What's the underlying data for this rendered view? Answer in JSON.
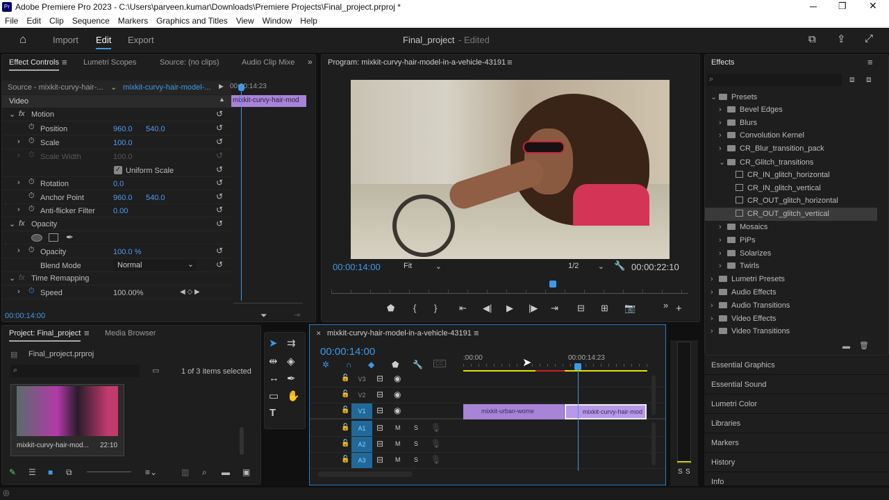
{
  "app": {
    "title": "Adobe Premiere Pro 2023 - C:\\Users\\parveen.kumar\\Downloads\\Premiere Projects\\Final_project.prproj *",
    "logo": "Pr"
  },
  "menu": [
    "File",
    "Edit",
    "Clip",
    "Sequence",
    "Markers",
    "Graphics and Titles",
    "View",
    "Window",
    "Help"
  ],
  "header": {
    "tabs": [
      "Import",
      "Edit",
      "Export"
    ],
    "active": "Edit",
    "project": "Final_project",
    "status": "- Edited"
  },
  "effect_controls": {
    "tabs": [
      "Effect Controls",
      "Lumetri Scopes",
      "Source: (no clips)",
      "Audio Clip Mixe"
    ],
    "source": "Source - mixkit-curvy-hair-...",
    "sequence": "mixkit-curvy-hair-model-...",
    "mini_time": "00:00:14:23",
    "mini_clip": "mixkit-curvy-hair-mod",
    "section": "Video",
    "motion": "Motion",
    "position": {
      "label": "Position",
      "x": "960.0",
      "y": "540.0"
    },
    "scale": {
      "label": "Scale",
      "v": "100.0"
    },
    "scale_width": {
      "label": "Scale Width",
      "v": "100.0"
    },
    "uniform": "Uniform Scale",
    "rotation": {
      "label": "Rotation",
      "v": "0.0"
    },
    "anchor": {
      "label": "Anchor Point",
      "x": "960.0",
      "y": "540.0"
    },
    "antiflicker": {
      "label": "Anti-flicker Filter",
      "v": "0.00"
    },
    "opacity_group": "Opacity",
    "opacity": {
      "label": "Opacity",
      "v": "100.0 %"
    },
    "blend": {
      "label": "Blend Mode",
      "v": "Normal"
    },
    "time_remap": "Time Remapping",
    "speed": {
      "label": "Speed",
      "v": "100.00%"
    },
    "timecode": "00:00:14:00"
  },
  "program": {
    "title": "Program: mixkit-curvy-hair-model-in-a-vehicle-43191",
    "timecode": "00:00:14:00",
    "fit": "Fit",
    "quality": "1/2",
    "duration": "00:00:22:10",
    "playhead_fraction": 0.62
  },
  "effects": {
    "title": "Effects",
    "tree": [
      {
        "label": "Presets",
        "level": 0,
        "open": true,
        "type": "folder"
      },
      {
        "label": "Bevel Edges",
        "level": 1,
        "type": "folder"
      },
      {
        "label": "Blurs",
        "level": 1,
        "type": "folder"
      },
      {
        "label": "Convolution Kernel",
        "level": 1,
        "type": "folder"
      },
      {
        "label": "CR_Blur_transition_pack",
        "level": 1,
        "type": "folder"
      },
      {
        "label": "CR_Glitch_transitions",
        "level": 1,
        "open": true,
        "type": "folder"
      },
      {
        "label": "CR_IN_glitch_horizontal",
        "level": 2,
        "type": "preset"
      },
      {
        "label": "CR_IN_glitch_vertical",
        "level": 2,
        "type": "preset"
      },
      {
        "label": "CR_OUT_glitch_horizontal",
        "level": 2,
        "type": "preset"
      },
      {
        "label": "CR_OUT_glitch_vertical",
        "level": 2,
        "type": "preset",
        "selected": true
      },
      {
        "label": "Mosaics",
        "level": 1,
        "type": "folder"
      },
      {
        "label": "PiPs",
        "level": 1,
        "type": "folder"
      },
      {
        "label": "Solarizes",
        "level": 1,
        "type": "folder"
      },
      {
        "label": "Twirls",
        "level": 1,
        "type": "folder"
      },
      {
        "label": "Lumetri Presets",
        "level": 0,
        "type": "folder"
      },
      {
        "label": "Audio Effects",
        "level": 0,
        "type": "folder"
      },
      {
        "label": "Audio Transitions",
        "level": 0,
        "type": "folder"
      },
      {
        "label": "Video Effects",
        "level": 0,
        "type": "folder"
      },
      {
        "label": "Video Transitions",
        "level": 0,
        "type": "folder"
      }
    ],
    "docks": [
      "Essential Graphics",
      "Essential Sound",
      "Lumetri Color",
      "Libraries",
      "Markers",
      "History",
      "Info"
    ]
  },
  "project": {
    "tabs": [
      "Project: Final_project",
      "Media Browser"
    ],
    "file": "Final_project.prproj",
    "selection": "1 of 3 items selected",
    "clip_name": "mixkit-curvy-hair-mod...",
    "clip_duration": "22:10"
  },
  "timeline": {
    "title": "mixkit-curvy-hair-model-in-a-vehicle-43191",
    "timecode": "00:00:14:00",
    "ruler": [
      ":00:00",
      "00:00:14:23"
    ],
    "video_tracks": [
      "V3",
      "V2",
      "V1"
    ],
    "audio_tracks": [
      "A1",
      "A2",
      "A3"
    ],
    "clips": [
      {
        "name": "mixkit-urban-wome"
      },
      {
        "name": "mixkit-curvy-hair-mod"
      }
    ],
    "cc": "CC"
  },
  "meter": {
    "solo": [
      "S",
      "S"
    ]
  },
  "colors": {
    "accent": "#3e9ae8",
    "clip": "#a884d8",
    "panel": "#1e1e1e"
  }
}
